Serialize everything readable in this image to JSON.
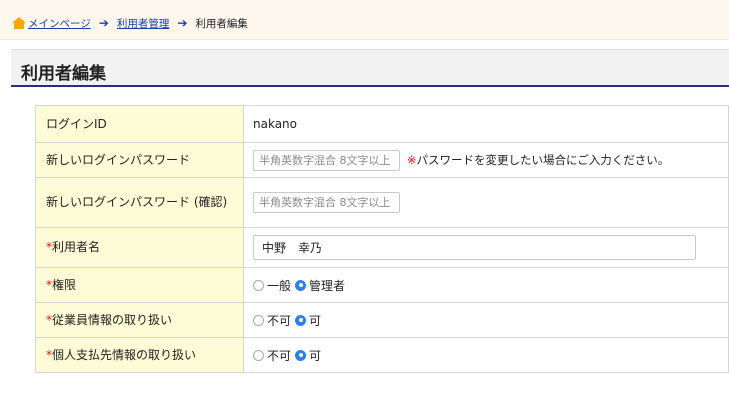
{
  "breadcrumb": {
    "home": "メインページ",
    "users": "利用者管理",
    "current": "利用者編集"
  },
  "page_title": "利用者編集",
  "form": {
    "login_id": {
      "label": "ログインID",
      "value": "nakano"
    },
    "new_password": {
      "label": "新しいログインパスワード",
      "placeholder": "半角英数字混合 8文字以上",
      "note_mark": "※",
      "note": "パスワードを変更したい場合にご入力ください。"
    },
    "confirm_password": {
      "label": "新しいログインパスワード (確認)",
      "placeholder": "半角英数字混合 8文字以上"
    },
    "user_name": {
      "required_mark": "*",
      "label": "利用者名",
      "value": "中野　幸乃"
    },
    "authority": {
      "required_mark": "*",
      "label": "権限",
      "options": [
        "一般",
        "管理者"
      ],
      "selected": "管理者"
    },
    "employee_info": {
      "required_mark": "*",
      "label": "従業員情報の取り扱い",
      "options": [
        "不可",
        "可"
      ],
      "selected": "可"
    },
    "payee_info": {
      "required_mark": "*",
      "label": "個人支払先情報の取り扱い",
      "options": [
        "不可",
        "可"
      ],
      "selected": "可"
    }
  },
  "colors": {
    "label_bg": "#fdfcd7",
    "title_underline": "#2a2d7a",
    "link": "#1a3ea8",
    "required": "#d91818",
    "radio_selected": "#2f7fe8"
  }
}
